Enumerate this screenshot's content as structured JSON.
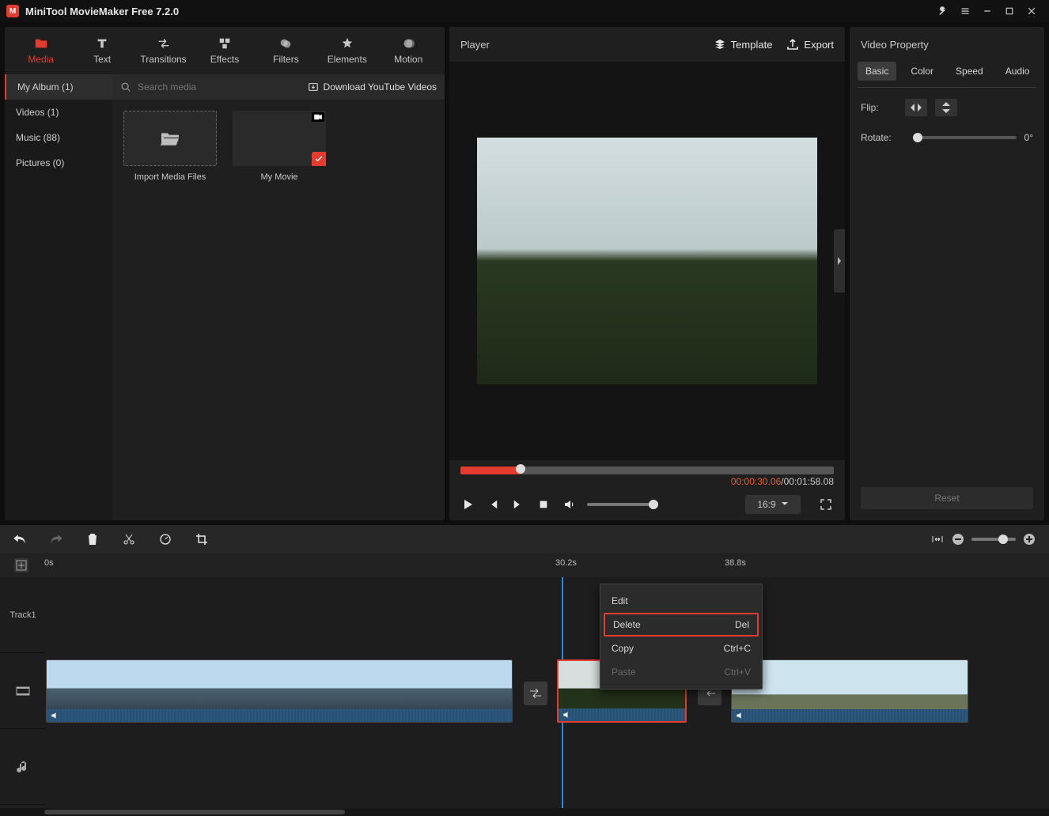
{
  "titlebar": {
    "app_title": "MiniTool MovieMaker Free 7.2.0"
  },
  "main_tabs": {
    "media": "Media",
    "text": "Text",
    "transitions": "Transitions",
    "effects": "Effects",
    "filters": "Filters",
    "elements": "Elements",
    "motion": "Motion"
  },
  "media_side": {
    "album": "My Album (1)",
    "videos": "Videos (1)",
    "music": "Music (88)",
    "pictures": "Pictures (0)"
  },
  "media": {
    "search_placeholder": "Search media",
    "download_label": "Download YouTube Videos",
    "import_label": "Import Media Files",
    "clip_label": "My Movie"
  },
  "player": {
    "title": "Player",
    "template_label": "Template",
    "export_label": "Export",
    "current_time": "00:00:30.06",
    "sep": " / ",
    "total_time": "00:01:58.08",
    "aspect": "16:9"
  },
  "props": {
    "title": "Video Property",
    "tabs": {
      "basic": "Basic",
      "color": "Color",
      "speed": "Speed",
      "audio": "Audio"
    },
    "flip_label": "Flip:",
    "rotate_label": "Rotate:",
    "rotate_value": "0°",
    "reset": "Reset"
  },
  "timeline": {
    "track1": "Track1",
    "ticks": {
      "t0": "0s",
      "t1": "30.2s",
      "t2": "38.8s"
    }
  },
  "context_menu": {
    "edit": "Edit",
    "delete": "Delete",
    "delete_sc": "Del",
    "copy": "Copy",
    "copy_sc": "Ctrl+C",
    "paste": "Paste",
    "paste_sc": "Ctrl+V"
  }
}
